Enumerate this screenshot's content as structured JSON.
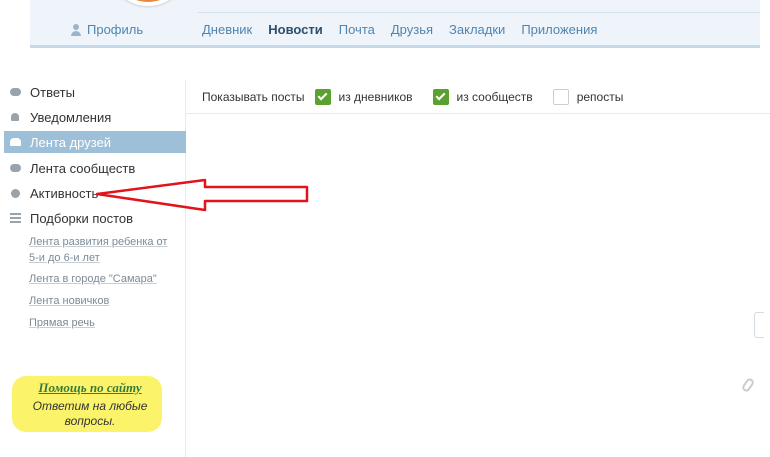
{
  "header": {
    "profile_label": "Профиль",
    "tabs": [
      {
        "label": "Дневник",
        "active": false
      },
      {
        "label": "Новости",
        "active": true
      },
      {
        "label": "Почта",
        "active": false
      },
      {
        "label": "Друзья",
        "active": false
      },
      {
        "label": "Закладки",
        "active": false
      },
      {
        "label": "Приложения",
        "active": false
      }
    ]
  },
  "sidebar": {
    "items": [
      {
        "label": "Ответы",
        "icon": "speech-bubble-icon"
      },
      {
        "label": "Уведомления",
        "icon": "bell-icon"
      },
      {
        "label": "Лента друзей",
        "icon": "people-icon",
        "active": true
      },
      {
        "label": "Лента сообществ",
        "icon": "speech-bubble-icon"
      },
      {
        "label": "Активность",
        "icon": "dot-icon"
      },
      {
        "label": "Подборки постов",
        "icon": "list-icon"
      }
    ],
    "sublinks": [
      "Лента развития ребенка от 5-и до 6-и лет",
      "Лента в городе \"Самара\"",
      "Лента новичков",
      "Прямая речь"
    ],
    "help": {
      "title": "Помощь по сайту",
      "text": "Ответим на любые вопросы."
    }
  },
  "filters": {
    "label": "Показывать посты",
    "options": [
      {
        "label": "из дневников",
        "checked": true
      },
      {
        "label": "из сообществ",
        "checked": true
      },
      {
        "label": "репосты",
        "checked": false
      }
    ]
  },
  "colors": {
    "accent": "#4f85b3",
    "active_item": "#9ebfd8",
    "checkbox": "#5aa12f",
    "arrow": "#e0141a",
    "help_highlight": "#fbf46a"
  }
}
